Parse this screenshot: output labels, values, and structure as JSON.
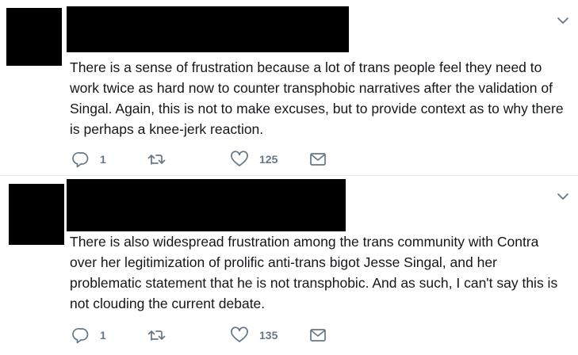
{
  "colors": {
    "text": "#14171a",
    "icon": "#657786",
    "divider": "#e6ecf0",
    "redaction": "#000000"
  },
  "tweets": [
    {
      "text": "There is a sense of frustration because a lot of trans people feel they need to work twice as hard now to counter transphobic narratives after the validation of Singal. Again, this is not to make excuses, but to provide context as to why there is perhaps a knee-jerk reaction.",
      "reply_count": "1",
      "retweet_count": "",
      "like_count": "125",
      "icons": [
        "chevron-down-icon",
        "reply-icon",
        "retweet-icon",
        "heart-icon",
        "envelope-icon"
      ]
    },
    {
      "text": "There is also widespread frustration among the trans community with Contra over her legitimization of prolific anti-trans bigot Jesse Singal, and her problematic statement that he is not transphobic. And as such, I can't say this is not clouding the current debate.",
      "reply_count": "1",
      "retweet_count": "",
      "like_count": "135",
      "icons": [
        "chevron-down-icon",
        "reply-icon",
        "retweet-icon",
        "heart-icon",
        "envelope-icon"
      ]
    }
  ]
}
